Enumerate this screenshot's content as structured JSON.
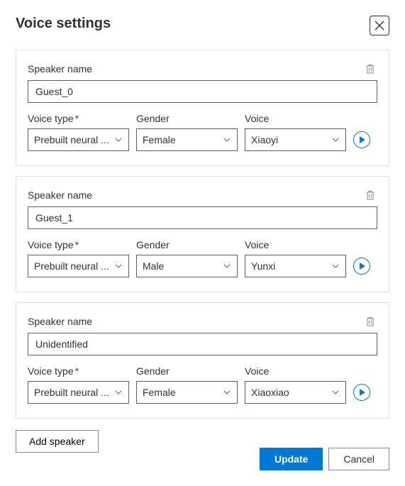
{
  "dialog": {
    "title": "Voice settings"
  },
  "labels": {
    "speaker_name": "Speaker name",
    "voice_type": "Voice type",
    "gender": "Gender",
    "voice": "Voice"
  },
  "speakers": [
    {
      "name": "Guest_0",
      "voice_type": "Prebuilt neural ...",
      "gender": "Female",
      "voice": "Xiaoyi"
    },
    {
      "name": "Guest_1",
      "voice_type": "Prebuilt neural ...",
      "gender": "Male",
      "voice": "Yunxi"
    },
    {
      "name": "Unidentified",
      "voice_type": "Prebuilt neural ...",
      "gender": "Female",
      "voice": "Xiaoxiao"
    }
  ],
  "buttons": {
    "add_speaker": "Add speaker",
    "update": "Update",
    "cancel": "Cancel"
  }
}
